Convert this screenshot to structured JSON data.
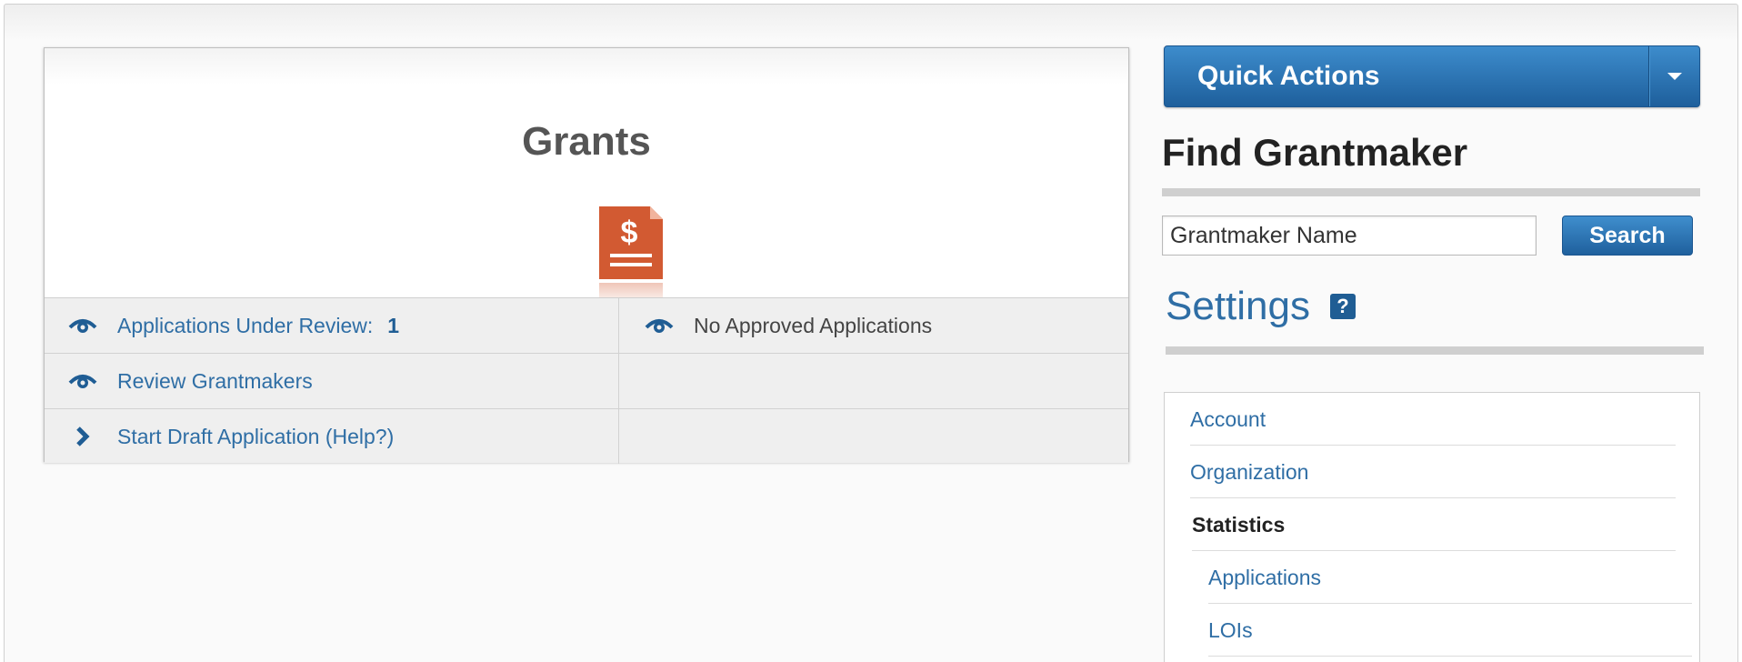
{
  "grants": {
    "title": "Grants",
    "icon": "dollar-document-icon",
    "rows": [
      {
        "left": {
          "icon": "eye-icon",
          "label": "Applications Under Review:",
          "count": "1"
        },
        "right": {
          "icon": "eye-icon",
          "label": "No Approved Applications"
        }
      },
      {
        "left": {
          "icon": "eye-icon",
          "label": "Review Grantmakers"
        }
      },
      {
        "left": {
          "icon": "chevron-right-icon",
          "label": "Start Draft Application (Help?)"
        }
      }
    ]
  },
  "quick_actions": {
    "label": "Quick Actions",
    "caret_icon": "caret-down-icon"
  },
  "find_grantmaker": {
    "title": "Find Grantmaker",
    "input_value": "Grantmaker Name",
    "search_label": "Search"
  },
  "settings": {
    "title": "Settings",
    "help_label": "?",
    "items": [
      {
        "label": "Account"
      },
      {
        "label": "Organization"
      },
      {
        "label": "Statistics"
      },
      {
        "label": "Applications"
      },
      {
        "label": "LOIs"
      }
    ]
  },
  "colors": {
    "accent_blue": "#2f6ea5",
    "button_blue": "#1f609d",
    "doc_orange": "#d25a32"
  }
}
